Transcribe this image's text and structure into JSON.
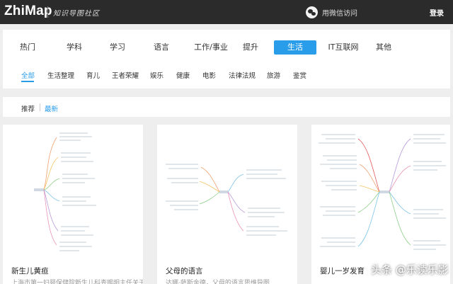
{
  "header": {
    "logo": "ZhiMap",
    "slogan": "知识导图社区",
    "wechat_login": "用微信访问",
    "login": "登录"
  },
  "categories": [
    {
      "label": "热门"
    },
    {
      "label": "学科"
    },
    {
      "label": "学习"
    },
    {
      "label": "语言"
    },
    {
      "label": "工作/事业"
    },
    {
      "label": "提升"
    },
    {
      "label": "生活",
      "active": true
    },
    {
      "label": "IT互联网"
    },
    {
      "label": "其他"
    }
  ],
  "subcategories": [
    {
      "label": "全部",
      "active": true
    },
    {
      "label": "生活整理"
    },
    {
      "label": "育儿"
    },
    {
      "label": "王者荣耀"
    },
    {
      "label": "娱乐"
    },
    {
      "label": "健康"
    },
    {
      "label": "电影"
    },
    {
      "label": "法律法规"
    },
    {
      "label": "旅游"
    },
    {
      "label": "鉴赏"
    }
  ],
  "sort": [
    {
      "label": "推荐"
    },
    {
      "label": "最新",
      "active": true
    }
  ],
  "cards": [
    {
      "title": "新生儿黄疸",
      "desc": "上海市第一妇婴保健院新生儿科查赐明主任关于新"
    },
    {
      "title": "父母的语言",
      "desc": "达娜·萨斯金德，父母的语言思维导图"
    },
    {
      "title": "婴儿一岁发育",
      "desc": ""
    }
  ],
  "watermark": "头条 @乐读乐影",
  "colors": {
    "accent": "#2a9dea",
    "topbar": "#2b2b2b"
  }
}
